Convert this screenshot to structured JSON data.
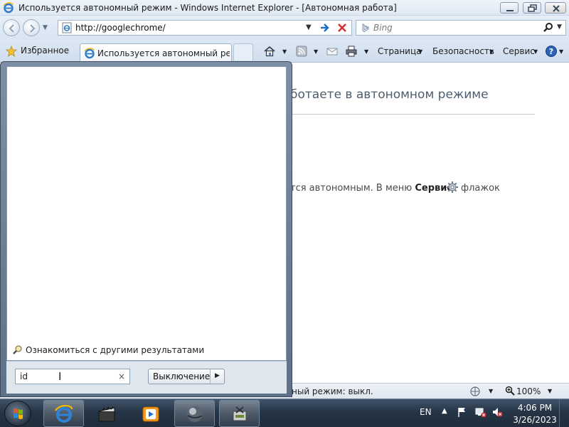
{
  "window": {
    "title": "Используется автономный режим - Windows Internet Explorer - [Автономная работа]",
    "icon": "ie-icon"
  },
  "address": {
    "url": "http://googlechrome/",
    "search_placeholder": "Bing"
  },
  "favorites": {
    "label": "Избранное",
    "tab_title": "Используется автономный реж..."
  },
  "commands": {
    "page": "Страница",
    "safety": "Безопасность",
    "tools": "Сервис"
  },
  "content": {
    "heading": "ботаете в автономном режиме",
    "body_start": "тся автономным. В меню",
    "body_bold": "Сервис",
    "body_end": "флажок"
  },
  "status": {
    "text": "ный режим: выкл.",
    "zoom": "100%"
  },
  "startmenu": {
    "more_results": "Ознакомиться с другими результатами",
    "search_value": "id",
    "clear": "×",
    "shutdown_label": "Выключение"
  },
  "taskbar": {
    "language": "EN",
    "time": "4:06 PM",
    "date": "3/26/2023"
  },
  "colors": {
    "titlebar": "#dfe8f3",
    "taskbar": "#263546",
    "startmenu_frame": "#6b7e95",
    "heading": "#4d5d70"
  }
}
